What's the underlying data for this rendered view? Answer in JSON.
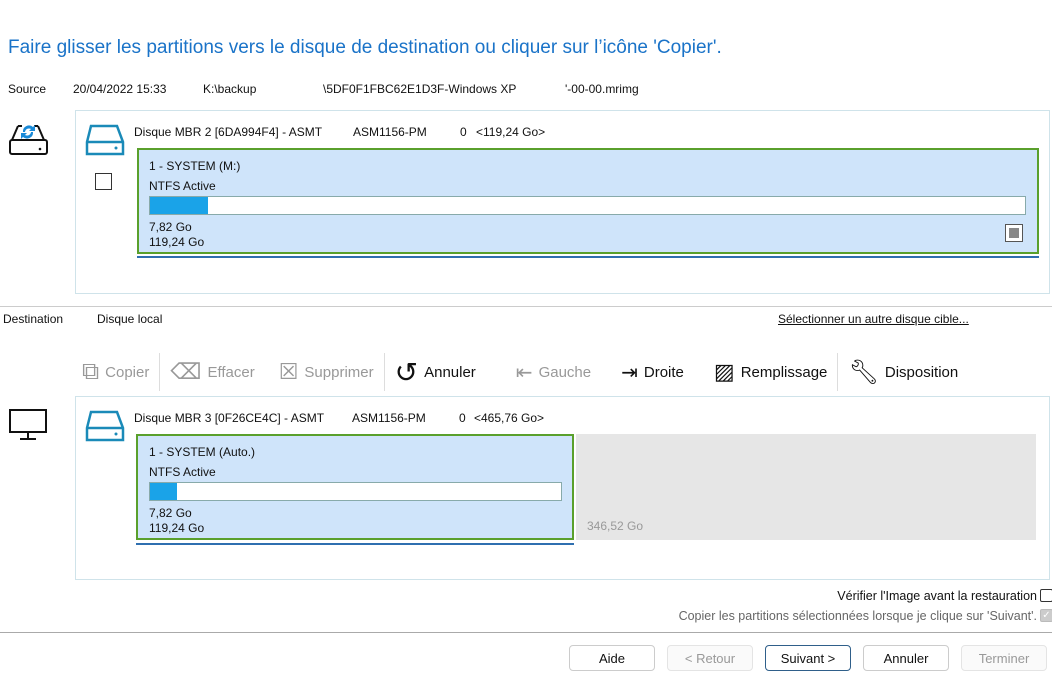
{
  "title": "Faire glisser les partitions vers le disque de destination ou cliquer sur l’icône 'Copier'.",
  "source": {
    "label": "Source",
    "date": "20/04/2022 15:33",
    "path": "K:\\backup",
    "file": "\\5DF0F1FBC62E1D3F-Windows XP",
    "suffix": "'-00-00.mrimg",
    "disk": {
      "name": "Disque MBR 2 [6DA994F4] - ASMT",
      "model": "ASM1156-PM",
      "index": "0",
      "size": "<119,24 Go>"
    },
    "partition": {
      "name": "1 - SYSTEM (M:)",
      "type": "NTFS Active",
      "used": "7,82 Go",
      "total": "119,24 Go",
      "used_fraction": 0.066
    }
  },
  "destination": {
    "label": "Destination",
    "disk_label": "Disque local",
    "select_link": "Sélectionner un autre disque cible...",
    "disk": {
      "name": "Disque MBR 3 [0F26CE4C] - ASMT",
      "model": "ASM1156-PM",
      "index": "0",
      "size": "<465,76 Go>"
    },
    "partition": {
      "name": "1 - SYSTEM (Auto.)",
      "type": "NTFS Active",
      "used": "7,82 Go",
      "total": "119,24 Go",
      "used_fraction": 0.066
    },
    "free": "346,52 Go"
  },
  "toolbar": {
    "copy": "Copier",
    "erase": "Effacer",
    "delete": "Supprimer",
    "undo": "Annuler",
    "left": "Gauche",
    "right": "Droite",
    "fill": "Remplissage",
    "layout": "Disposition"
  },
  "options": {
    "verify": "Vérifier l'Image avant la restauration",
    "copy_selected": "Copier les partitions sélectionnées lorsque je clique sur 'Suivant'."
  },
  "buttons": {
    "help": "Aide",
    "back": "< Retour",
    "next": "Suivant >",
    "cancel": "Annuler",
    "finish": "Terminer"
  }
}
